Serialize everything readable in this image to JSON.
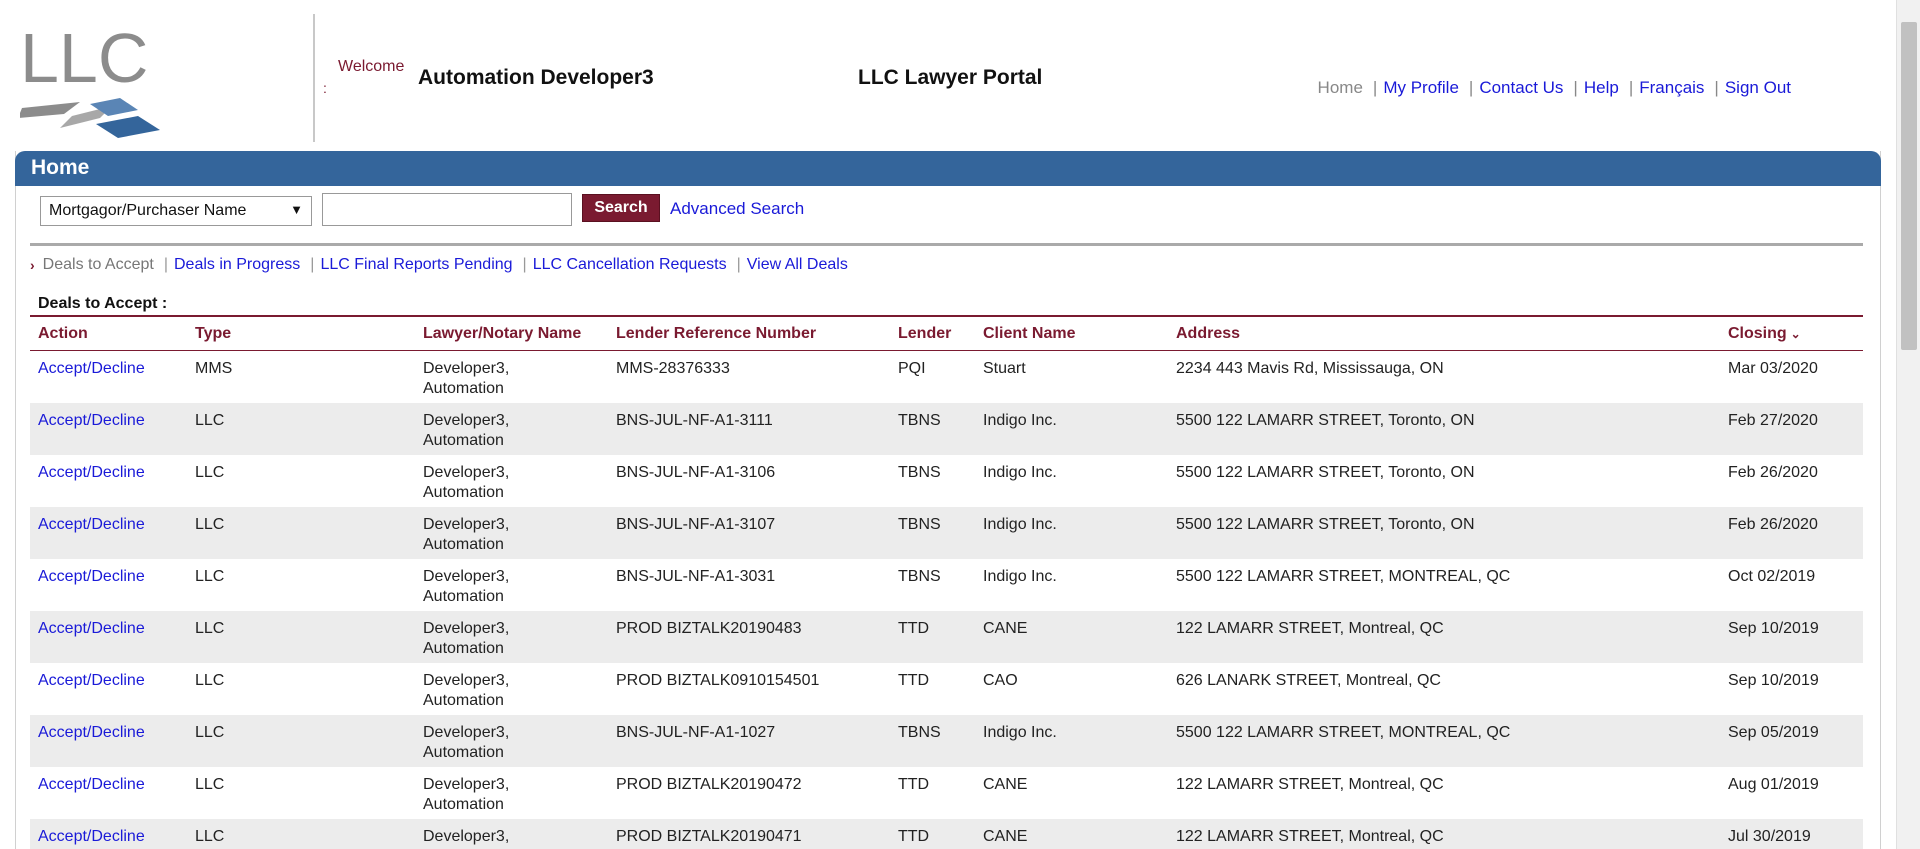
{
  "header": {
    "logo_text": "LLC",
    "welcome_label": "Welcome",
    "welcome_colon": ":",
    "user_name": "Automation Developer3",
    "portal_title": "LLC Lawyer Portal",
    "nav": {
      "home": "Home",
      "my_profile": "My Profile",
      "contact_us": "Contact Us",
      "help": "Help",
      "francais": "Français",
      "sign_out": "Sign Out"
    }
  },
  "home_bar": {
    "title": "Home"
  },
  "search": {
    "type_selected": "Mortgagor/Purchaser Name",
    "input_value": "",
    "button_label": "Search",
    "advanced_label": "Advanced Search"
  },
  "sub_nav": {
    "current": "Deals to Accept",
    "items": [
      "Deals in Progress",
      "LLC Final Reports Pending",
      "LLC Cancellation Requests",
      "View All Deals"
    ]
  },
  "section_title": "Deals to Accept :",
  "table": {
    "headers": {
      "action": "Action",
      "type": "Type",
      "lawyer": "Lawyer/Notary Name",
      "ref": "Lender Reference Number",
      "lender": "Lender",
      "client": "Client Name",
      "address": "Address",
      "closing": "Closing"
    },
    "rows": [
      {
        "action": "Accept/Decline",
        "type": "MMS",
        "lawyer1": "Developer3,",
        "lawyer2": "Automation",
        "ref": "MMS-28376333",
        "lender": "PQI",
        "client": "Stuart",
        "address": "2234 443 Mavis Rd, Mississauga, ON",
        "closing": "Mar 03/2020"
      },
      {
        "action": "Accept/Decline",
        "type": "LLC",
        "lawyer1": "Developer3,",
        "lawyer2": "Automation",
        "ref": "BNS-JUL-NF-A1-3111",
        "lender": "TBNS",
        "client": "Indigo Inc.",
        "address": "5500 122 LAMARR STREET, Toronto, ON",
        "closing": "Feb 27/2020"
      },
      {
        "action": "Accept/Decline",
        "type": "LLC",
        "lawyer1": "Developer3,",
        "lawyer2": "Automation",
        "ref": "BNS-JUL-NF-A1-3106",
        "lender": "TBNS",
        "client": "Indigo Inc.",
        "address": "5500 122 LAMARR STREET, Toronto, ON",
        "closing": "Feb 26/2020"
      },
      {
        "action": "Accept/Decline",
        "type": "LLC",
        "lawyer1": "Developer3,",
        "lawyer2": "Automation",
        "ref": "BNS-JUL-NF-A1-3107",
        "lender": "TBNS",
        "client": "Indigo Inc.",
        "address": "5500 122 LAMARR STREET, Toronto, ON",
        "closing": "Feb 26/2020"
      },
      {
        "action": "Accept/Decline",
        "type": "LLC",
        "lawyer1": "Developer3,",
        "lawyer2": "Automation",
        "ref": "BNS-JUL-NF-A1-3031",
        "lender": "TBNS",
        "client": "Indigo Inc.",
        "address": "5500 122 LAMARR STREET, MONTREAL, QC",
        "closing": "Oct 02/2019"
      },
      {
        "action": "Accept/Decline",
        "type": "LLC",
        "lawyer1": "Developer3,",
        "lawyer2": "Automation",
        "ref": "PROD BIZTALK20190483",
        "lender": "TTD",
        "client": "CANE",
        "address": "122 LAMARR STREET, Montreal, QC",
        "closing": "Sep 10/2019"
      },
      {
        "action": "Accept/Decline",
        "type": "LLC",
        "lawyer1": "Developer3,",
        "lawyer2": "Automation",
        "ref": "PROD BIZTALK0910154501",
        "lender": "TTD",
        "client": "CAO",
        "address": "626 LANARK STREET, Montreal, QC",
        "closing": "Sep 10/2019"
      },
      {
        "action": "Accept/Decline",
        "type": "LLC",
        "lawyer1": "Developer3,",
        "lawyer2": "Automation",
        "ref": "BNS-JUL-NF-A1-1027",
        "lender": "TBNS",
        "client": "Indigo Inc.",
        "address": "5500 122 LAMARR STREET, MONTREAL, QC",
        "closing": "Sep 05/2019"
      },
      {
        "action": "Accept/Decline",
        "type": "LLC",
        "lawyer1": "Developer3,",
        "lawyer2": "Automation",
        "ref": "PROD BIZTALK20190472",
        "lender": "TTD",
        "client": "CANE",
        "address": "122 LAMARR STREET, Montreal, QC",
        "closing": "Aug 01/2019"
      },
      {
        "action": "Accept/Decline",
        "type": "LLC",
        "lawyer1": "Developer3,",
        "lawyer2": "",
        "ref": "PROD BIZTALK20190471",
        "lender": "TTD",
        "client": "CANE",
        "address": "122 LAMARR STREET, Montreal, QC",
        "closing": "Jul 30/2019"
      }
    ]
  },
  "colors": {
    "brand_blue": "#34659b",
    "maroon": "#7a1a30",
    "link_blue": "#1a1ad8",
    "row_alt": "#ececec"
  }
}
